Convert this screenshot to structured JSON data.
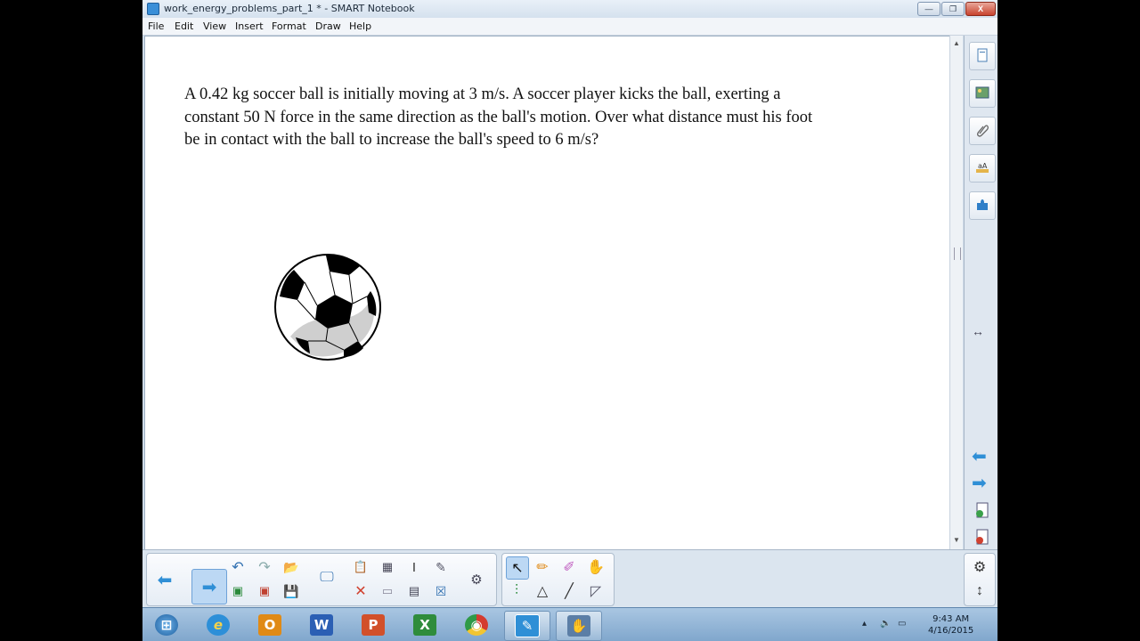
{
  "window": {
    "title": "work_energy_problems_part_1 * - SMART Notebook",
    "minimize_label": "—",
    "restore_label": "❐",
    "close_label": "X"
  },
  "menu": [
    "File",
    "Edit",
    "View",
    "Insert",
    "Format",
    "Draw",
    "Help"
  ],
  "page": {
    "problem_text": "A 0.42 kg soccer ball is initially moving at 3 m/s. A soccer player kicks the ball, exerting a\nconstant 50 N force in the same direction as the ball's motion. Over what distance must his foot\nbe in contact with the ball to increase the ball's speed to 6 m/s?"
  },
  "side_tabs": [
    "page-sorter",
    "gallery",
    "attachments",
    "properties",
    "add-ons"
  ],
  "side_controls": {
    "resize_glyph": "↔",
    "prev_glyph": "⬅",
    "next_glyph": "➡"
  },
  "toolbar": {
    "back_glyph": "⬅",
    "forward_glyph": "➡",
    "settings_glyph": "⚙",
    "move_glyph": "↕"
  },
  "taskbar": {
    "apps": [
      {
        "name": "start",
        "glyph": "⊞",
        "color": "#1d6fb8"
      },
      {
        "name": "internet-explorer",
        "glyph": "e",
        "color": "#2d8fd8"
      },
      {
        "name": "outlook",
        "glyph": "O",
        "color": "#e08a16"
      },
      {
        "name": "word",
        "glyph": "W",
        "color": "#2b5fb4"
      },
      {
        "name": "powerpoint",
        "glyph": "P",
        "color": "#d2502a"
      },
      {
        "name": "excel",
        "glyph": "X",
        "color": "#2f8c3c"
      },
      {
        "name": "chrome",
        "glyph": "◉",
        "color": "#d43b2f"
      },
      {
        "name": "smart-notebook",
        "glyph": "✎",
        "color": "#2f8fd6"
      },
      {
        "name": "smart-tools",
        "glyph": "✋",
        "color": "#5b7ea6"
      }
    ],
    "time": "9:43 AM",
    "date": "4/16/2015"
  }
}
